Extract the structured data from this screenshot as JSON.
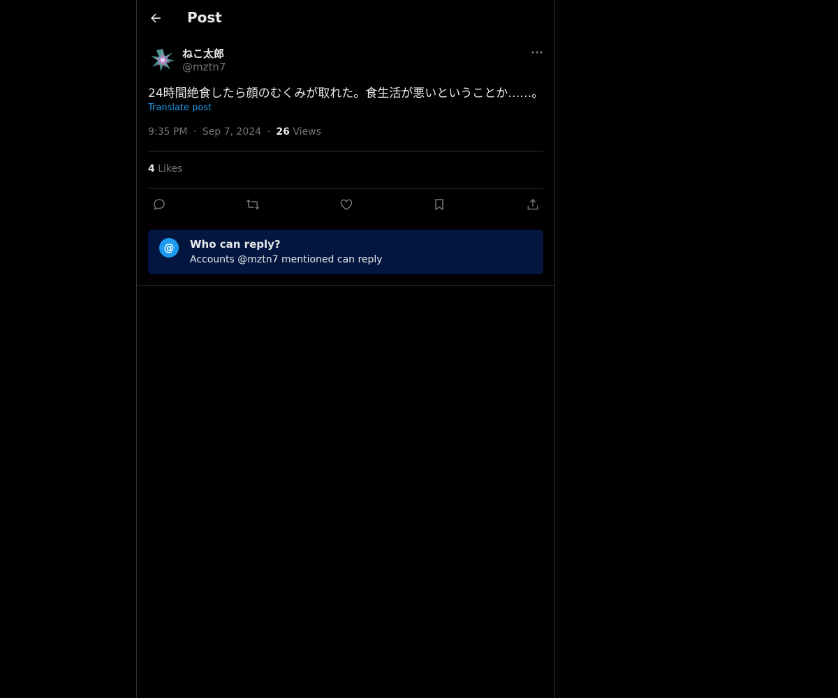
{
  "header": {
    "back_icon": "arrow-left-icon",
    "title": "Post"
  },
  "post": {
    "author_name": "ねこ太郎",
    "author_handle": "@mztn7",
    "more_icon": "ellipsis-icon",
    "text": "24時間絶食したら顔のむくみが取れた。食生活が悪いということか……。",
    "translate_label": "Translate post",
    "time": "9:35 PM",
    "separator": "·",
    "date": "Sep 7, 2024",
    "views_count": "26",
    "views_label": "Views",
    "likes_count": "4",
    "likes_label": "Likes"
  },
  "actions": [
    {
      "name": "reply",
      "icon": "reply-icon"
    },
    {
      "name": "repost",
      "icon": "repost-icon"
    },
    {
      "name": "like",
      "icon": "heart-icon"
    },
    {
      "name": "bookmark",
      "icon": "bookmark-icon"
    },
    {
      "name": "share",
      "icon": "share-icon"
    }
  ],
  "reply_restriction": {
    "icon_glyph": "@",
    "title": "Who can reply?",
    "subtitle": "Accounts @mztn7 mentioned can reply"
  },
  "colors": {
    "background": "#000000",
    "accent": "#1d9bf0",
    "text_primary": "#e7e9ea",
    "text_secondary": "#71767b",
    "border": "#2f3336",
    "reply_box_bg": "#031640"
  }
}
